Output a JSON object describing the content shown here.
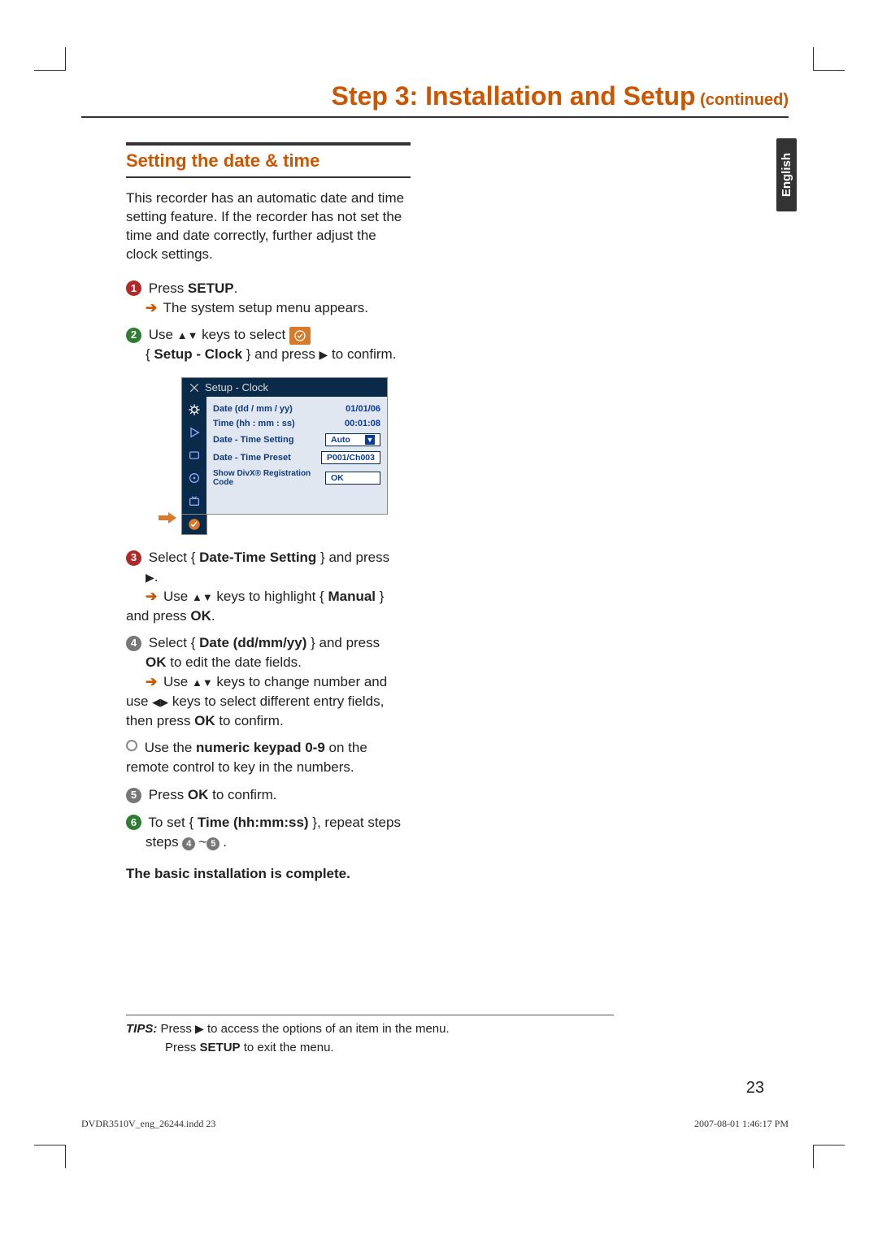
{
  "page_title_main": "Step 3: Installation and Setup",
  "page_title_cont": " (continued)",
  "lang_tab": "English",
  "section_heading": "Setting the date & time",
  "intro": "This recorder has an automatic date and time setting feature. If the recorder has not set the time and date correctly, further adjust the clock settings.",
  "step1_a": "Press ",
  "step1_b": "SETUP",
  "step1_c": ".",
  "step1_res": "The system setup menu appears.",
  "step2_a": "Use ",
  "step2_b": " keys to select ",
  "step2_c": "{ ",
  "step2_d": "Setup - Clock",
  "step2_e": " } and press ",
  "step2_f": " to confirm.",
  "osd": {
    "title": "Setup - Clock",
    "rows": [
      {
        "label": "Date (dd / mm / yy)",
        "value": "01/01/06",
        "box": false
      },
      {
        "label": "Time (hh : mm : ss)",
        "value": "00:01:08",
        "box": false
      },
      {
        "label": "Date - Time Setting",
        "value": "Auto",
        "box": true,
        "dropdown": true
      },
      {
        "label": "Date - Time Preset",
        "value": "P001/Ch003",
        "box": true,
        "dropdown": false
      },
      {
        "label": "Show DivX® Registration Code",
        "value": "OK",
        "box": true,
        "dropdown": false
      }
    ]
  },
  "step3_a": "Select { ",
  "step3_b": "Date-Time Setting",
  "step3_c": " } and press ",
  "step3_d": ".",
  "step3_res_a": " Use ",
  "step3_res_b": " keys to highlight { ",
  "step3_res_c": "Manual",
  "step3_res_d": " } and press ",
  "step3_res_e": "OK",
  "step3_res_f": ".",
  "step4_a": "Select { ",
  "step4_b": "Date (dd/mm/yy)",
  "step4_c": " } and press ",
  "step4_d": "OK",
  "step4_e": " to edit the date fields.",
  "step4_res_a": " Use ",
  "step4_res_b": " keys to change number and use ",
  "step4_res_c": " keys to select different entry fields, then press ",
  "step4_res_d": "OK",
  "step4_res_e": " to confirm.",
  "bullet_a": "Use the ",
  "bullet_b": "numeric keypad 0-9",
  "bullet_c": " on the remote control to key in the numbers.",
  "step5_a": "Press ",
  "step5_b": "OK",
  "step5_c": " to confirm.",
  "step6_a": "To set { ",
  "step6_b": "Time (hh:mm:ss)",
  "step6_c": " }, repeat steps ",
  "step6_d": "~",
  "step6_e": ".",
  "complete": "The basic installation is complete.",
  "tips_label": "TIPS:",
  "tips_1a": " Press ",
  "tips_1b": " to access the options of an item in the menu.",
  "tips_2a": "Press ",
  "tips_2b": "SETUP",
  "tips_2c": " to exit the menu.",
  "pagenum": "23",
  "footer_left": "DVDR3510V_eng_26244.indd   23",
  "footer_right": "2007-08-01   1:46:17 PM"
}
